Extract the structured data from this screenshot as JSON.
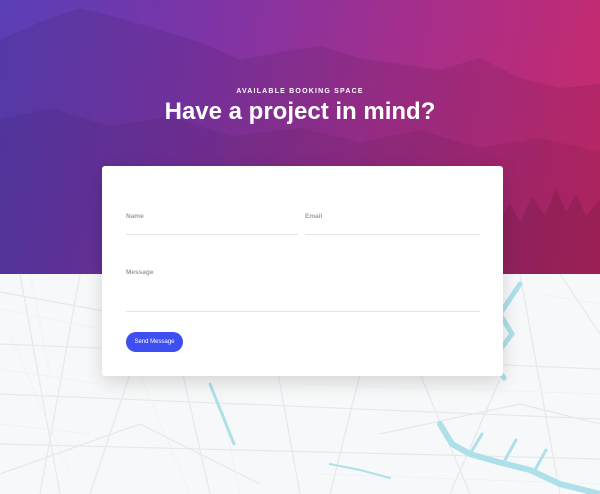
{
  "hero": {
    "eyebrow": "AVAILABLE BOOKING SPACE",
    "title": "Have a project in mind?"
  },
  "form": {
    "name_label": "Name",
    "email_label": "Email",
    "message_label": "Message",
    "name_value": "",
    "email_value": "",
    "message_value": "",
    "submit_label": "Send Message"
  },
  "colors": {
    "gradient_start": "#5a3fb6",
    "gradient_end": "#c92a6c",
    "button": "#3f4ef0",
    "map_water": "#aee0ea"
  }
}
